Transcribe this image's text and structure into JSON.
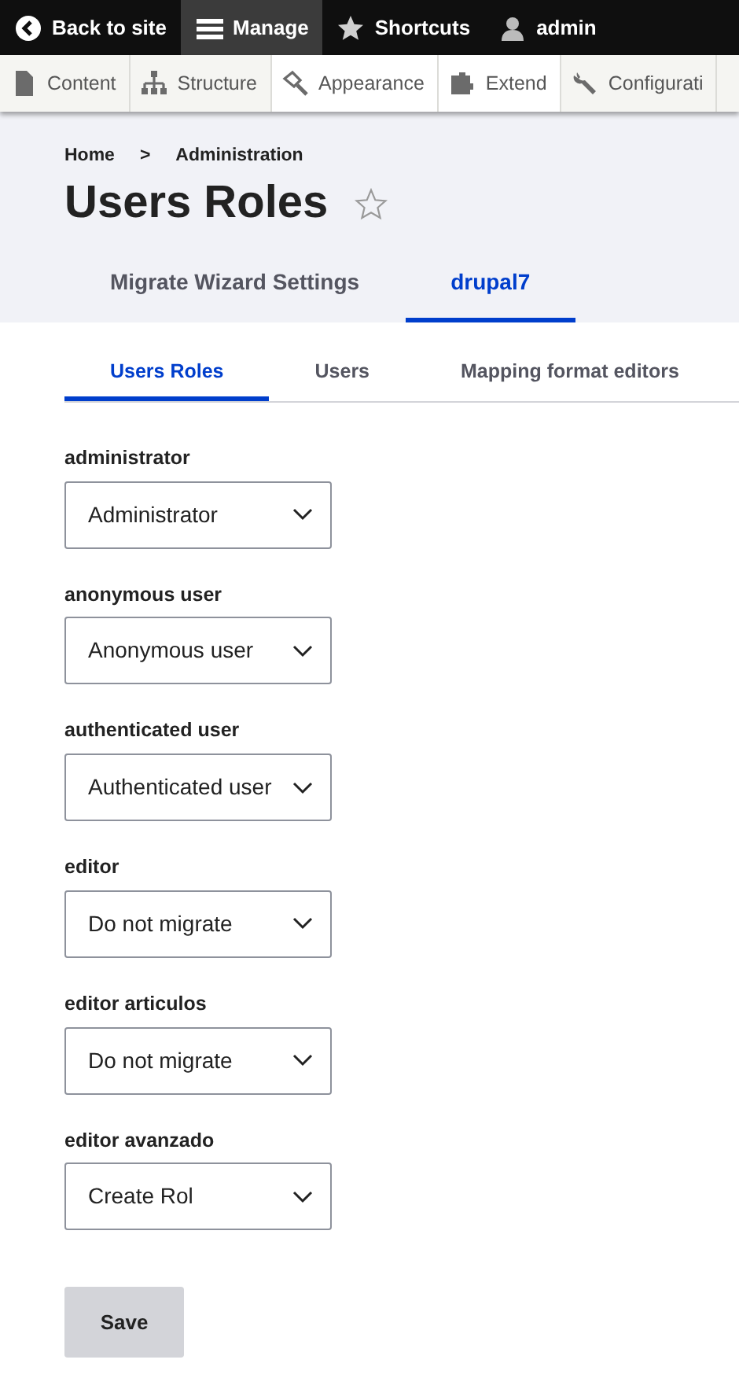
{
  "toolbar": [
    {
      "label": "Back to site",
      "kind": "back",
      "selected": false
    },
    {
      "label": "Manage",
      "kind": "menu",
      "selected": true
    },
    {
      "label": "Shortcuts",
      "kind": "star",
      "selected": false
    },
    {
      "label": "admin",
      "kind": "user",
      "selected": false
    }
  ],
  "tray": [
    {
      "label": "Content",
      "kind": "file",
      "highlighted": false
    },
    {
      "label": "Structure",
      "kind": "tree",
      "highlighted": false
    },
    {
      "label": "Appearance",
      "kind": "brush",
      "highlighted": true
    },
    {
      "label": "Extend",
      "kind": "puzzle",
      "highlighted": true
    },
    {
      "label": "Configurati",
      "kind": "wrench",
      "highlighted": false
    }
  ],
  "breadcrumb": [
    "Home",
    "Administration"
  ],
  "breadcrumb_separator": ">",
  "page_title": "Users Roles",
  "primary_tabs": [
    {
      "label": "Migrate Wizard Settings",
      "selected": false
    },
    {
      "label": "drupal7",
      "selected": true
    }
  ],
  "secondary_tabs": [
    {
      "label": "Users Roles",
      "selected": true
    },
    {
      "label": "Users",
      "selected": false
    },
    {
      "label": "Mapping format editors",
      "selected": false
    }
  ],
  "fields": [
    {
      "label": "administrator",
      "value": "Administrator"
    },
    {
      "label": "anonymous user",
      "value": "Anonymous user"
    },
    {
      "label": "authenticated user",
      "value": "Authenticated user"
    },
    {
      "label": "editor",
      "value": "Do not migrate"
    },
    {
      "label": "editor articulos",
      "value": "Do not migrate"
    },
    {
      "label": "editor avanzado",
      "value": "Create Rol"
    }
  ],
  "save_button": "Save"
}
